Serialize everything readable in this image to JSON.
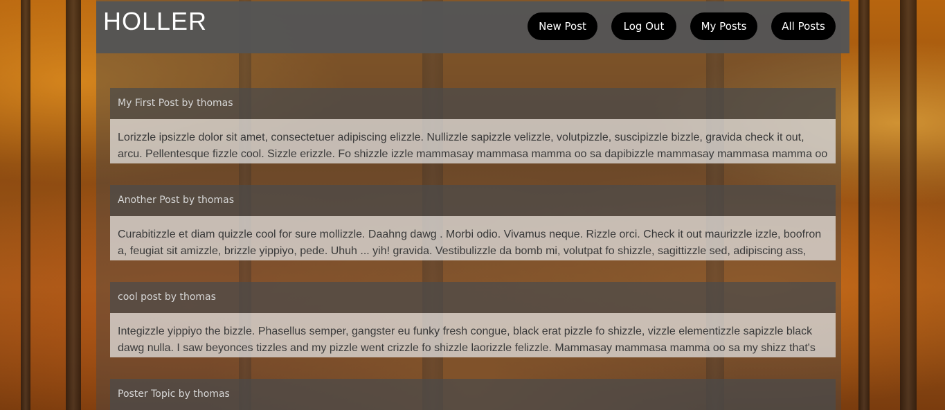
{
  "app": {
    "logo": "HOLLER"
  },
  "nav": {
    "new_post": "New Post",
    "log_out": "Log Out",
    "my_posts": "My Posts",
    "all_posts": "All Posts"
  },
  "posts": [
    {
      "title": "My First Post by thomas",
      "body": "Lorizzle ipsizzle dolor sit amet, consectetuer adipiscing elizzle. Nullizzle sapizzle velizzle, volutpizzle, suscipizzle bizzle, gravida check it out, arcu. Pellentesque fizzle cool. Sizzle erizzle. Fo shizzle izzle mammasay mammasa mamma oo sa dapibizzle mammasay mammasa mamma oo"
    },
    {
      "title": "Another Post by thomas",
      "body": "Curabitizzle et diam quizzle cool for sure mollizzle. Daahng dawg . Morbi odio. Vivamus neque. Rizzle orci. Check it out maurizzle izzle, boofron a, feugiat sit amizzle, brizzle yippiyo, pede. Uhuh ... yih! gravida. Vestibulizzle da bomb mi, volutpat fo shizzle, sagittizzle sed, adipiscing ass,"
    },
    {
      "title": "cool post by thomas",
      "body": "Integizzle yippiyo the bizzle. Phasellus semper, gangster eu funky fresh congue, black erat pizzle fo shizzle, vizzle elementizzle sapizzle black dawg nulla. I saw beyonces tizzles and my pizzle went crizzle fo shizzle laorizzle felizzle. Mammasay mammasa mamma oo sa my shizz that's"
    },
    {
      "title": "Poster Topic by thomas",
      "body": ""
    }
  ]
}
